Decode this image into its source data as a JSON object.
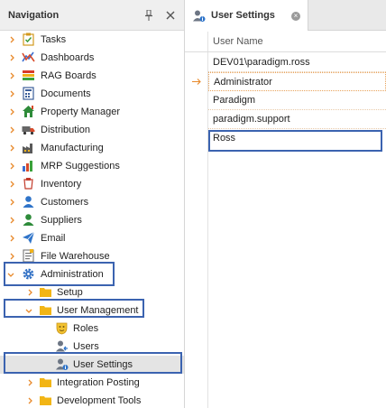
{
  "navigation": {
    "title": "Navigation",
    "items": [
      {
        "label": "Tasks",
        "icon": "tasks-icon"
      },
      {
        "label": "Dashboards",
        "icon": "dashboards-icon"
      },
      {
        "label": "RAG Boards",
        "icon": "rag-boards-icon"
      },
      {
        "label": "Documents",
        "icon": "documents-icon"
      },
      {
        "label": "Property Manager",
        "icon": "property-manager-icon"
      },
      {
        "label": "Distribution",
        "icon": "distribution-icon"
      },
      {
        "label": "Manufacturing",
        "icon": "manufacturing-icon"
      },
      {
        "label": "MRP Suggestions",
        "icon": "mrp-suggestions-icon"
      },
      {
        "label": "Inventory",
        "icon": "inventory-icon"
      },
      {
        "label": "Customers",
        "icon": "customers-icon"
      },
      {
        "label": "Suppliers",
        "icon": "suppliers-icon"
      },
      {
        "label": "Email",
        "icon": "email-icon"
      },
      {
        "label": "File Warehouse",
        "icon": "file-warehouse-icon"
      },
      {
        "label": "Administration",
        "icon": "gear-icon"
      },
      {
        "label": "Setup",
        "icon": "folder-icon"
      },
      {
        "label": "User Management",
        "icon": "folder-icon"
      },
      {
        "label": "Roles",
        "icon": "roles-icon"
      },
      {
        "label": "Users",
        "icon": "users-icon"
      },
      {
        "label": "User Settings",
        "icon": "user-settings-icon"
      },
      {
        "label": "Integration Posting",
        "icon": "folder-icon"
      },
      {
        "label": "Development Tools",
        "icon": "folder-icon"
      }
    ]
  },
  "tab": {
    "title": "User Settings"
  },
  "grid": {
    "column": "User Name",
    "rows": [
      "DEV01\\paradigm.ross",
      "Administrator",
      "Paradigm",
      "paradigm.support",
      "Ross"
    ]
  },
  "colors": {
    "accent_orange": "#e8892a",
    "highlight_blue": "#3b63b0",
    "folder_yellow": "#f2b515"
  }
}
